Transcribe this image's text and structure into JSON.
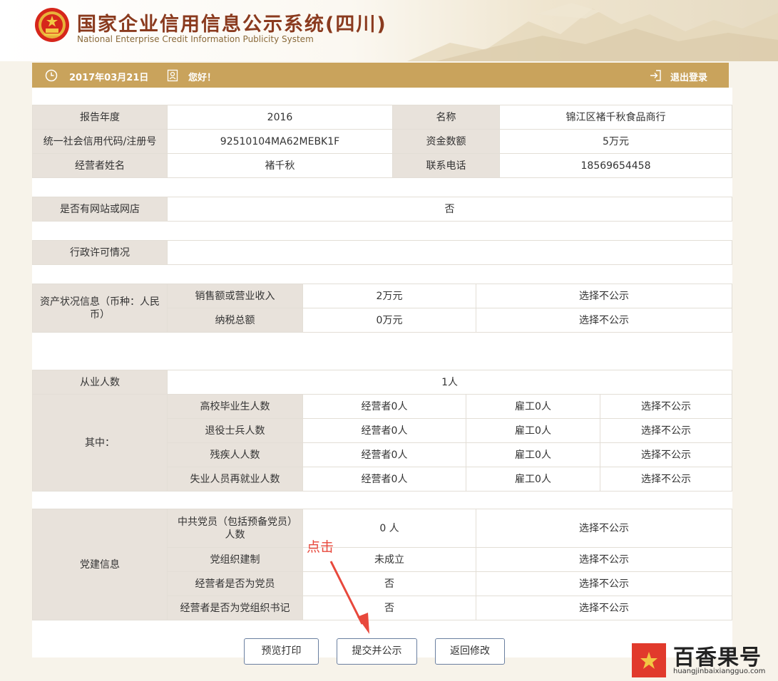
{
  "header": {
    "title": "国家企业信用信息公示系统(四川)",
    "subtitle": "National Enterprise Credit Information Publicity System"
  },
  "top_bar": {
    "date": "2017年03月21日",
    "greeting": "您好！",
    "logout": "退出登录",
    "icons": [
      "clock-icon",
      "user-icon",
      "logout-icon"
    ]
  },
  "basic_info": {
    "rows": [
      [
        "报告年度",
        "2016",
        "名称",
        "锦江区褚千秋食品商行"
      ],
      [
        "统一社会信用代码/注册号",
        "92510104MA62MEBK1F",
        "资金数额",
        "5万元"
      ],
      [
        "经营者姓名",
        "褚千秋",
        "联系电话",
        "18569654458"
      ]
    ]
  },
  "website": {
    "label": "是否有网站或网店",
    "value": "否"
  },
  "license": {
    "label": "行政许可情况",
    "value": ""
  },
  "assets": {
    "label": "资产状况信息（币种：人民币）",
    "rows": [
      [
        "销售额或营业收入",
        "2万元",
        "选择不公示"
      ],
      [
        "纳税总额",
        "0万元",
        "选择不公示"
      ]
    ]
  },
  "employees": {
    "label": "从业人数",
    "value": "1人",
    "sub_label": "其中：",
    "rows": [
      [
        "高校毕业生人数",
        "经营者0人",
        "雇工0人",
        "选择不公示"
      ],
      [
        "退役士兵人数",
        "经营者0人",
        "雇工0人",
        "选择不公示"
      ],
      [
        "残疾人人数",
        "经营者0人",
        "雇工0人",
        "选择不公示"
      ],
      [
        "失业人员再就业人数",
        "经营者0人",
        "雇工0人",
        "选择不公示"
      ]
    ]
  },
  "party": {
    "label": "党建信息",
    "rows": [
      [
        "中共党员（包括预备党员）人数",
        "0 人",
        "选择不公示"
      ],
      [
        "党组织建制",
        "未成立",
        "选择不公示"
      ],
      [
        "经营者是否为党员",
        "否",
        "选择不公示"
      ],
      [
        "经营者是否为党组织书记",
        "否",
        "选择不公示"
      ]
    ]
  },
  "buttons": {
    "preview": "预览打印",
    "submit": "提交并公示",
    "back": "返回修改"
  },
  "annotation": "点击",
  "watermark": {
    "name": "百香果号",
    "url": "huangjinbaixiangguo.com"
  },
  "colors": {
    "gold_bar": "#c9a35c",
    "label_bg": "#e8e2db",
    "title_red": "#8a3a1e",
    "annotation_red": "#e8483c"
  }
}
